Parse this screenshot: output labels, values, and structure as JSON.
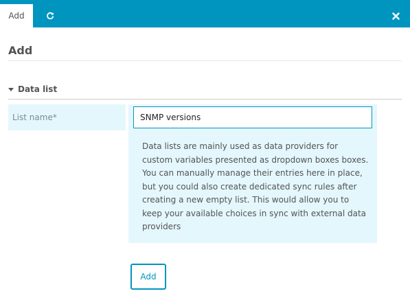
{
  "tabs": {
    "active_label": "Add",
    "refresh_icon": "refresh-icon"
  },
  "close_icon": "close-icon",
  "page": {
    "title": "Add"
  },
  "fieldset": {
    "legend": "Data list",
    "list_name_label": "List name*",
    "list_name_value": "SNMP versions",
    "help": "Data lists are mainly used as data providers for custom variables presented as dropdown boxes boxes. You can manually manage their entries here in place, but you could also create dedicated sync rules after creating a new empty list. This would allow you to keep your available choices in sync with external data providers"
  },
  "submit_label": "Add",
  "colors": {
    "accent": "#0095bf",
    "field_background": "#e4f7fd"
  }
}
